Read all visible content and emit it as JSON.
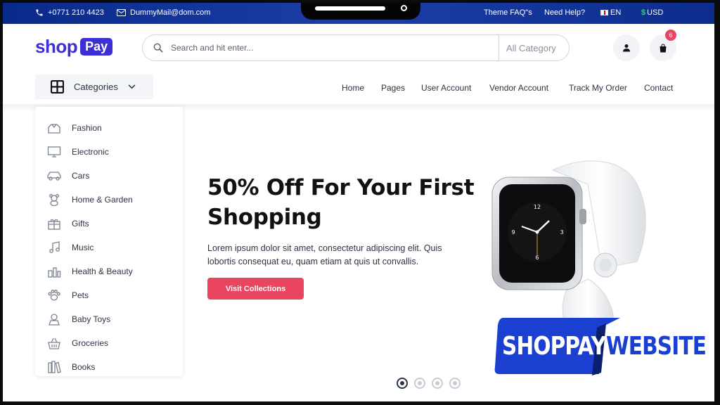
{
  "topbar": {
    "phone": "+0771 210 4423",
    "email": "DummyMail@dom.com",
    "faq": "Theme FAQ\"s",
    "help": "Need Help?",
    "language": "EN",
    "currency": "USD",
    "currency_symbol": "$"
  },
  "header": {
    "logo_shop": "shop",
    "logo_pay": "Pay",
    "search_placeholder": "Search and hit enter...",
    "search_category": "All Category",
    "cart_count": "6"
  },
  "nav": {
    "categories_label": "Categories",
    "links": [
      "Home",
      "Pages",
      "User Account",
      "Vendor Account",
      "Track My Order",
      "Contact"
    ]
  },
  "sidebar": {
    "items": [
      "Fashion",
      "Electronic",
      "Cars",
      "Home & Garden",
      "Gifts",
      "Music",
      "Health & Beauty",
      "Pets",
      "Baby Toys",
      "Groceries",
      "Books"
    ]
  },
  "hero": {
    "headline_line1": "50% Off For Your First",
    "headline_line2": "Shopping",
    "paragraph_line1": "Lorem ipsum dolor sit amet, consectetur adipiscing elit. Quis",
    "paragraph_line2": "lobortis consequat eu, quam etiam at quis ut convallis.",
    "cta": "Visit Collections",
    "active_slide": 1,
    "slide_count": 4
  },
  "overlay": {
    "word1": "SHOPPAY",
    "word2": "WEBSITE"
  },
  "colors": {
    "brand": "#3d2fd6",
    "accent": "#e94560",
    "topbar": "#0a2a8a",
    "overlay_blue": "#1a3fd1"
  }
}
